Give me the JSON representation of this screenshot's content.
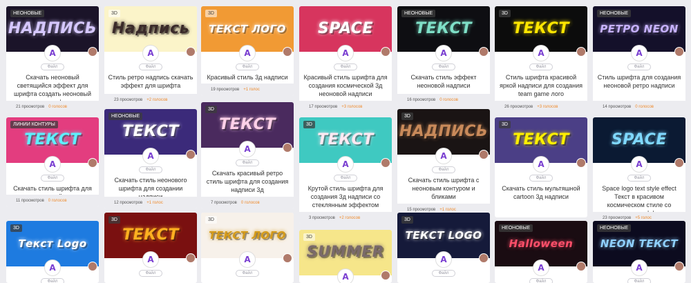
{
  "file_label": "Файл",
  "cards": [
    {
      "tag": "НЕОНОВЫЕ",
      "thumb_text": "НАДПИСЬ",
      "title": "Скачать неоновый светящийся эффект для шрифта создать неоновый текст на фото",
      "views": "21 просмотров",
      "votes": "0 голосов",
      "bg": "#1b1429",
      "fg": "#d6c8ff"
    },
    {
      "tag": "3D",
      "thumb_text": "Надпись",
      "title": "Стиль ретро надпись скачать эффект для шрифта",
      "views": "23 просмотров",
      "votes": "+2 голосов",
      "bg": "#fbf4c9",
      "fg": "#3a2a2a"
    },
    {
      "tag": "3D",
      "thumb_text": "ТЕКСТ ЛОГО",
      "title": "Красивый стиль 3д надписи",
      "views": "19 просмотров",
      "votes": "+1 голос",
      "bg": "#f19a34",
      "fg": "#ffffff"
    },
    {
      "tag": "",
      "thumb_text": "SPACE",
      "title": "Красивый стиль шрифта для создания космической 3д неоновой надписи",
      "views": "17 просмотров",
      "votes": "+3 голосов",
      "bg": "#d7355e",
      "fg": "#ffffff"
    },
    {
      "tag": "НЕОНОВЫЕ",
      "thumb_text": "ТЕКСТ",
      "title": "Скачать стиль эффект неоновой надписи",
      "views": "16 просмотров",
      "votes": "0 голосов",
      "bg": "#0e0e12",
      "fg": "#7fe0c8"
    },
    {
      "tag": "3D",
      "thumb_text": "ТЕКСТ",
      "title": "Стиль шрифта красивой яркой надписи для создания team game лого",
      "views": "26 просмотров",
      "votes": "+3 голосов",
      "bg": "#0c0c0c",
      "fg": "#ffe600"
    },
    {
      "tag": "НЕОНОВЫЕ",
      "thumb_text": "РЕТРО NEON",
      "title": "Стиль шрифта для создания неоновой ретро надписи",
      "views": "14 просмотров",
      "votes": "0 голосов",
      "bg": "#14102a",
      "fg": "#c7b2ff"
    },
    {
      "tag": "ЛИНИИ КОНТУРЫ",
      "thumb_text": "ТЕКСТ",
      "title": "Скачать стиль шрифта для создания яркой надписи",
      "views": "11 просмотров",
      "votes": "0 голосов",
      "bg": "#e33d7f",
      "fg": "#5ef0ff"
    },
    {
      "tag": "НЕОНОВЫЕ",
      "thumb_text": "ТЕКСТ",
      "title": "Скачать стиль неонового шрифта для создании надписи",
      "views": "12 просмотров",
      "votes": "+1 голос",
      "bg": "#3b2a7a",
      "fg": "#ffffff"
    },
    {
      "tag": "3D",
      "thumb_text": "ТЕКСТ",
      "title": "Скачать красивый ретро стиль шрифта для создания надписи 3д",
      "views": "7 просмотров",
      "votes": "0 голосов",
      "bg": "#4a2a5e",
      "fg": "#ffd1e8"
    },
    {
      "tag": "3D",
      "thumb_text": "ТЕКСТ",
      "title": "Крутой стиль шрифта для создания 3д надписи со стеклянным эффектом",
      "views": "3 просмотров",
      "votes": "+2 голосов",
      "bg": "#3fc9c1",
      "fg": "#ffe9f2"
    },
    {
      "tag": "3D",
      "thumb_text": "НАДПИСЬ",
      "title": "Скачать стиль шрифта с неоновым контуром и бликами",
      "views": "15 просмотров",
      "votes": "+1 голос",
      "bg": "#1a1414",
      "fg": "#c98a5a"
    },
    {
      "tag": "3D",
      "thumb_text": "ТЕКСТ",
      "title": "Скачать стиль мультяшной cartoon 3д надписи",
      "views": "",
      "votes": "",
      "bg": "#4b3f86",
      "fg": "#fff000"
    },
    {
      "tag": "",
      "thumb_text": "SPACE",
      "title": "Space logo text style effect Текст в красивом космическом стиле со светящимся эффектом",
      "views": "23 просмотров",
      "votes": "+5 голос",
      "bg": "#0b1a33",
      "fg": "#7fd8ff"
    },
    {
      "tag": "3D",
      "thumb_text": "Текст Logo",
      "title": "",
      "views": "",
      "votes": "",
      "bg": "#1e7be0",
      "fg": "#ffffff"
    },
    {
      "tag": "3D",
      "thumb_text": "ТЕКСТ",
      "title": "",
      "views": "",
      "votes": "",
      "bg": "#7a1010",
      "fg": "#ffb020"
    },
    {
      "tag": "3D",
      "thumb_text": "ТЕКСТ ЛОГО",
      "title": "",
      "views": "",
      "votes": "",
      "bg": "#f7f1ea",
      "fg": "#d49a1a"
    },
    {
      "tag": "3D",
      "thumb_text": "SUMMER",
      "title": "",
      "views": "",
      "votes": "",
      "bg": "#f6e68a",
      "fg": "#7a6a6a"
    },
    {
      "tag": "3D",
      "thumb_text": "ТЕКСТ LOGO",
      "title": "",
      "views": "",
      "votes": "",
      "bg": "#151a3a",
      "fg": "#ffffff"
    },
    {
      "tag": "НЕОНОВЫЕ",
      "thumb_text": "Halloween",
      "title": "",
      "views": "",
      "votes": "",
      "bg": "#1a0c12",
      "fg": "#ff4f6a"
    },
    {
      "tag": "НЕОНОВЫЕ",
      "thumb_text": "NEON ТЕКСТ",
      "title": "",
      "views": "",
      "votes": "",
      "bg": "#0c0b1f",
      "fg": "#8fd0ff"
    }
  ]
}
